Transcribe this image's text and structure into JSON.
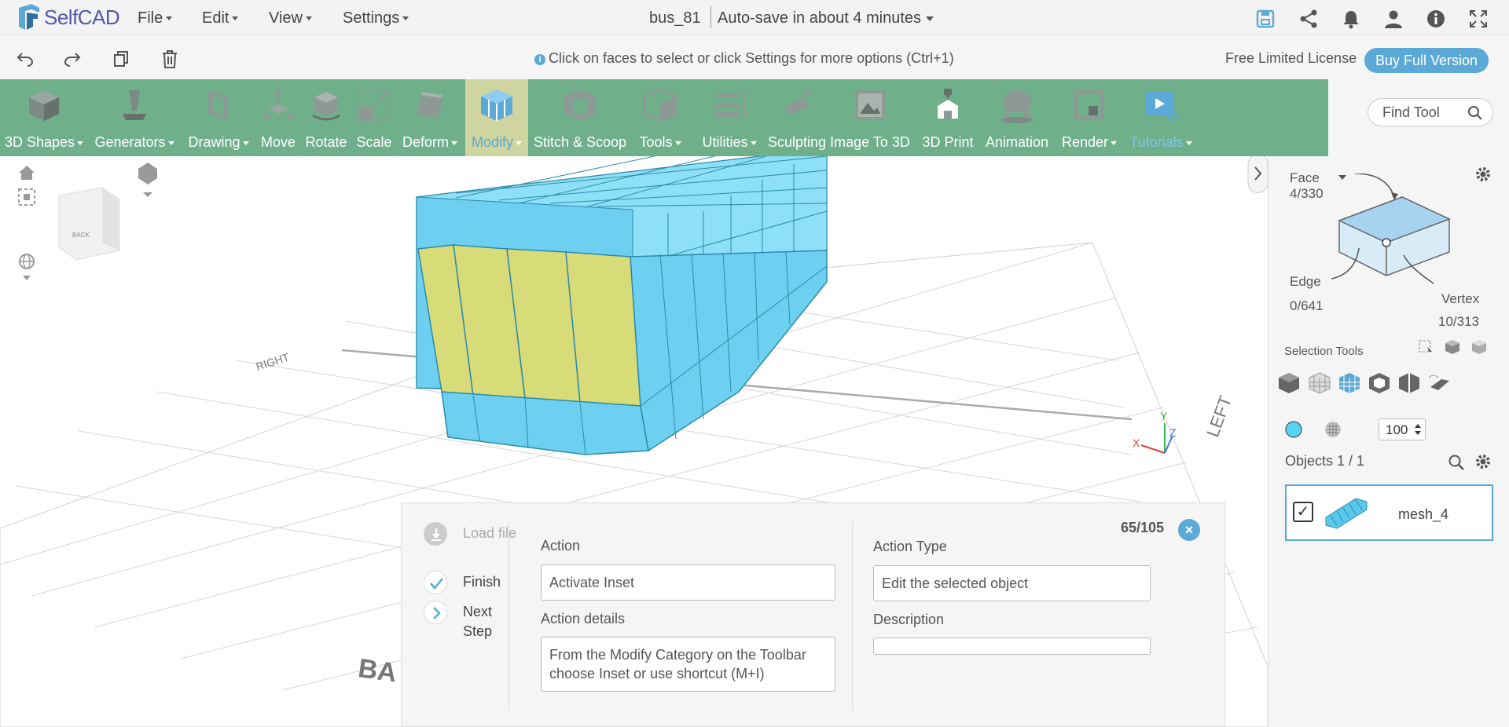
{
  "app": {
    "logo": "SelfCAD"
  },
  "menu": {
    "file": "File",
    "edit": "Edit",
    "view": "View",
    "settings": "Settings"
  },
  "document": {
    "title": "bus_81",
    "autosave": "Auto-save in about 4 minutes"
  },
  "hint": "Click on faces to select or click Settings for more options (Ctrl+1)",
  "license": {
    "label": "Free Limited License",
    "buy": "Buy Full Version"
  },
  "toolbar": [
    {
      "label": "3D Shapes",
      "dropdown": true
    },
    {
      "label": "Generators",
      "dropdown": true
    },
    {
      "label": "Drawing",
      "dropdown": true
    },
    {
      "label": "Move",
      "dropdown": false
    },
    {
      "label": "Rotate",
      "dropdown": false
    },
    {
      "label": "Scale",
      "dropdown": false
    },
    {
      "label": "Deform",
      "dropdown": true
    },
    {
      "label": "Modify",
      "dropdown": true,
      "active": true
    },
    {
      "label": "Stitch & Scoop",
      "dropdown": false
    },
    {
      "label": "Tools",
      "dropdown": true
    },
    {
      "label": "Utilities",
      "dropdown": true
    },
    {
      "label": "Sculpting",
      "dropdown": false
    },
    {
      "label": "Image To 3D",
      "dropdown": false
    },
    {
      "label": "3D Print",
      "dropdown": false
    },
    {
      "label": "Animation",
      "dropdown": false
    },
    {
      "label": "Render",
      "dropdown": true
    },
    {
      "label": "Tutorials",
      "dropdown": true
    }
  ],
  "find_tool": {
    "placeholder": "Find Tool"
  },
  "viewport": {
    "view_cube_label": "BACK",
    "grid_labels": {
      "left": "LEFT",
      "right": "RIGHT",
      "back": "BA"
    },
    "axes": {
      "x": "X",
      "y": "Y",
      "z": "Z"
    }
  },
  "selection": {
    "face": {
      "label": "Face",
      "count": "4/330"
    },
    "edge": {
      "label": "Edge",
      "count": "0/641"
    },
    "vertex": {
      "label": "Vertex",
      "count": "10/313"
    },
    "tools_title": "Selection Tools",
    "brush_size": "100"
  },
  "objects": {
    "title": "Objects 1 / 1",
    "items": [
      {
        "name": "mesh_4",
        "checked": true
      }
    ]
  },
  "tutorial": {
    "steps": [
      {
        "label": "Load file",
        "state": "disabled"
      },
      {
        "label": "Finish",
        "state": "done"
      },
      {
        "label": "Next Step",
        "state": "next"
      }
    ],
    "counter": "65/105",
    "action_label": "Action",
    "action_value": "Activate Inset",
    "action_details_label": "Action details",
    "action_details_value": "From the Modify Category on the Toolbar choose Inset or use shortcut (M+I)",
    "action_type_label": "Action Type",
    "action_type_value": "Edit the selected object",
    "description_label": "Description",
    "description_value": ""
  },
  "colors": {
    "toolbar_bg": "#6faf8a",
    "accent": "#5aa9d6",
    "mesh": "#6dd0f0",
    "selected_face": "#d8dc78"
  }
}
